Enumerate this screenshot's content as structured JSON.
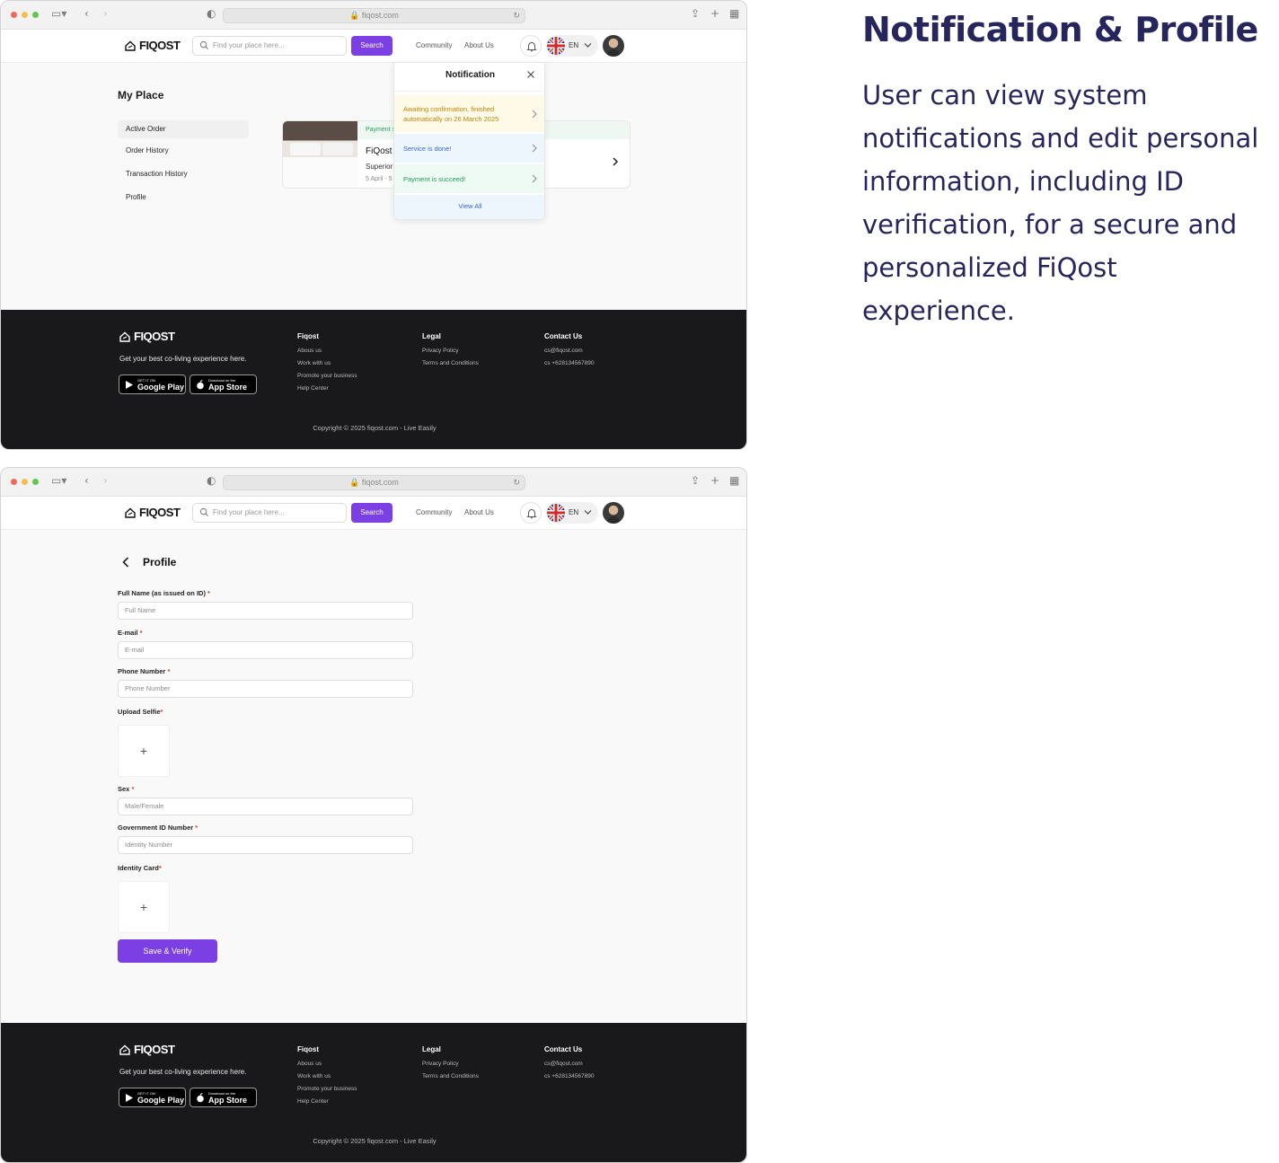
{
  "description": {
    "title": "Notification & Profile",
    "body": "User can view system notifications and edit personal information, including ID verification, for a secure and personalized FiQost experience."
  },
  "browser": {
    "url": "fiqost.com"
  },
  "nav": {
    "logo": "FIQOST",
    "search_placeholder": "Find your place here...",
    "search_button": "Search",
    "links": [
      "Community",
      "About Us"
    ],
    "language": "EN"
  },
  "my_place": {
    "title": "My Place",
    "menu": [
      "Active Order",
      "Order History",
      "Transaction History",
      "Profile"
    ],
    "active_menu": "Active Order",
    "order": {
      "status": "Payment s",
      "name": "FiQost",
      "room": "Superior",
      "date": "5 April - 5"
    }
  },
  "notification": {
    "title": "Notification",
    "items": [
      {
        "text": "Awaiting confirmation, finished automatically on 26 March 2025",
        "tone": "warning"
      },
      {
        "text": "Service is done!",
        "tone": "info"
      },
      {
        "text": "Payment is succeed!",
        "tone": "success"
      }
    ],
    "view_all": "View All"
  },
  "profile": {
    "title": "Profile",
    "fields": {
      "full_name": {
        "label": "Full Name (as issued on ID)",
        "placeholder": "Full Name"
      },
      "email": {
        "label": "E-mail",
        "placeholder": "E-mail"
      },
      "phone": {
        "label": "Phone Number",
        "placeholder": "Phone Number"
      },
      "selfie": {
        "label": "Upload Selfie"
      },
      "sex": {
        "label": "Sex",
        "placeholder": "Male/Female"
      },
      "gov_id": {
        "label": "Government ID Number",
        "placeholder": "Identity Number"
      },
      "id_card": {
        "label": "Identity Card"
      }
    },
    "required_mark": "*",
    "upload_symbol": "+",
    "save_button": "Save & Verify"
  },
  "footer": {
    "logo": "FIQOST",
    "tagline": "Get your best co-living experience here.",
    "google_play": {
      "small": "GET IT ON",
      "big": "Google Play"
    },
    "app_store": {
      "small": "Download on the",
      "big": "App Store"
    },
    "columns": [
      {
        "heading": "Fiqost",
        "links": [
          "Abous us",
          "Work with us",
          "Promote your business",
          "Help Center"
        ]
      },
      {
        "heading": "Legal",
        "links": [
          "Privacy Policy",
          "Terms and Conditions"
        ]
      },
      {
        "heading": "Contact Us",
        "links": [
          "cs@fiqost.com",
          "cs +628134567890"
        ]
      }
    ],
    "copyright": "Copyright © 2025 fiqost.com - Live Easily"
  },
  "colors": {
    "accent": "#7b3fe4",
    "heading": "#26265c",
    "footer_bg": "#19191b",
    "warning": "#b8860b",
    "info": "#3a62c9",
    "success": "#27985a"
  }
}
